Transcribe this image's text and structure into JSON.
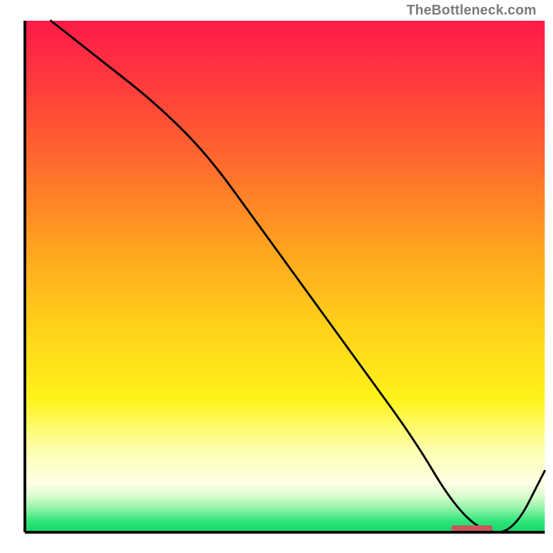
{
  "chart_data": {
    "type": "line",
    "title": "",
    "xlabel": "",
    "ylabel": "",
    "xlim": [
      0,
      100
    ],
    "ylim": [
      0,
      100
    ],
    "series": [
      {
        "name": "curve",
        "x": [
          5,
          15,
          25,
          35,
          45,
          55,
          65,
          75,
          82,
          88,
          94,
          100
        ],
        "values": [
          100,
          92,
          84,
          74,
          60,
          46,
          32,
          18,
          6,
          0,
          0,
          12
        ]
      }
    ],
    "optimum_band": {
      "x_start": 82,
      "x_end": 90,
      "y": 0
    },
    "background_gradient": {
      "stops": [
        {
          "pos": 0.0,
          "color": "#ff1a47"
        },
        {
          "pos": 0.12,
          "color": "#ff3a3d"
        },
        {
          "pos": 0.28,
          "color": "#ff6b2d"
        },
        {
          "pos": 0.44,
          "color": "#ffa21f"
        },
        {
          "pos": 0.6,
          "color": "#ffd21a"
        },
        {
          "pos": 0.74,
          "color": "#fff31a"
        },
        {
          "pos": 0.84,
          "color": "#fdffb0"
        },
        {
          "pos": 0.905,
          "color": "#fdffe6"
        },
        {
          "pos": 0.93,
          "color": "#d8fccc"
        },
        {
          "pos": 0.955,
          "color": "#8cf2a5"
        },
        {
          "pos": 0.978,
          "color": "#31e57a"
        },
        {
          "pos": 1.0,
          "color": "#17d66a"
        }
      ]
    }
  },
  "watermark": "TheBottleneck.com",
  "colors": {
    "axis": "#000000",
    "curve": "#000000",
    "optimum_marker": "#c9575e"
  }
}
